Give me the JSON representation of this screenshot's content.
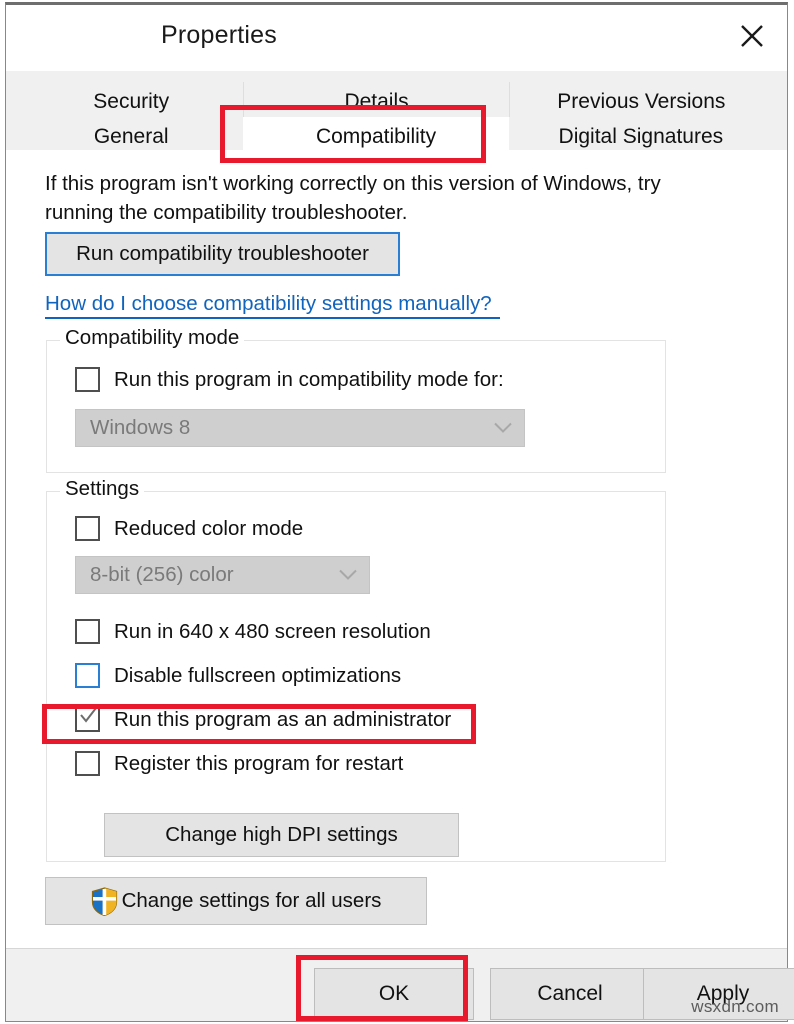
{
  "window": {
    "title": "Properties",
    "close_icon": "close-icon"
  },
  "tabs": {
    "row_top": [
      {
        "label": "Security",
        "selected": false
      },
      {
        "label": "Details",
        "selected": false
      },
      {
        "label": "Previous Versions",
        "selected": false
      }
    ],
    "row_bottom": [
      {
        "label": "General",
        "selected": false
      },
      {
        "label": "Compatibility",
        "selected": true
      },
      {
        "label": "Digital Signatures",
        "selected": false
      }
    ]
  },
  "main": {
    "intro_text": "If this program isn't working correctly on this version of Windows, try running the compatibility troubleshooter.",
    "troubleshooter_button": "Run compatibility troubleshooter",
    "help_link": "How do I choose compatibility settings manually?"
  },
  "compatibility_mode": {
    "legend": "Compatibility mode",
    "checkbox": {
      "label": "Run this program in compatibility mode for:",
      "checked": false,
      "focused": false
    },
    "dropdown": {
      "value": "Windows 8",
      "enabled": false,
      "chevron_icon": "chevron-down-icon"
    }
  },
  "settings": {
    "legend": "Settings",
    "reduced_color": {
      "label": "Reduced color mode",
      "checked": false,
      "focused": false
    },
    "color_depth_dropdown": {
      "value": "8-bit (256) color",
      "enabled": false,
      "chevron_icon": "chevron-down-icon"
    },
    "low_resolution": {
      "label": "Run in 640 x 480 screen resolution",
      "checked": false,
      "focused": false
    },
    "disable_fullscreen": {
      "label": "Disable fullscreen optimizations",
      "checked": false,
      "focused": true
    },
    "run_as_admin": {
      "label": "Run this program as an administrator",
      "checked": true,
      "focused": false
    },
    "register_restart": {
      "label": "Register this program for restart",
      "checked": false,
      "focused": false
    },
    "dpi_button": "Change high DPI settings"
  },
  "all_users_button": {
    "label": "Change settings for all users",
    "icon": "uac-shield-icon"
  },
  "footer": {
    "ok": "OK",
    "cancel": "Cancel",
    "apply": "Apply"
  },
  "watermark": "wsxdn.com",
  "annotations": {
    "color": "#e8192c",
    "highlighted": [
      "compatibility-tab",
      "run-as-administrator-checkbox",
      "ok-button"
    ]
  },
  "colors": {
    "link": "#1064bd",
    "focus_border": "#2a7fd4",
    "annotation_red": "#e8192c",
    "shield_blue": "#1a72c4",
    "shield_gold": "#f0b323",
    "disabled_text": "#7a7a7a"
  }
}
